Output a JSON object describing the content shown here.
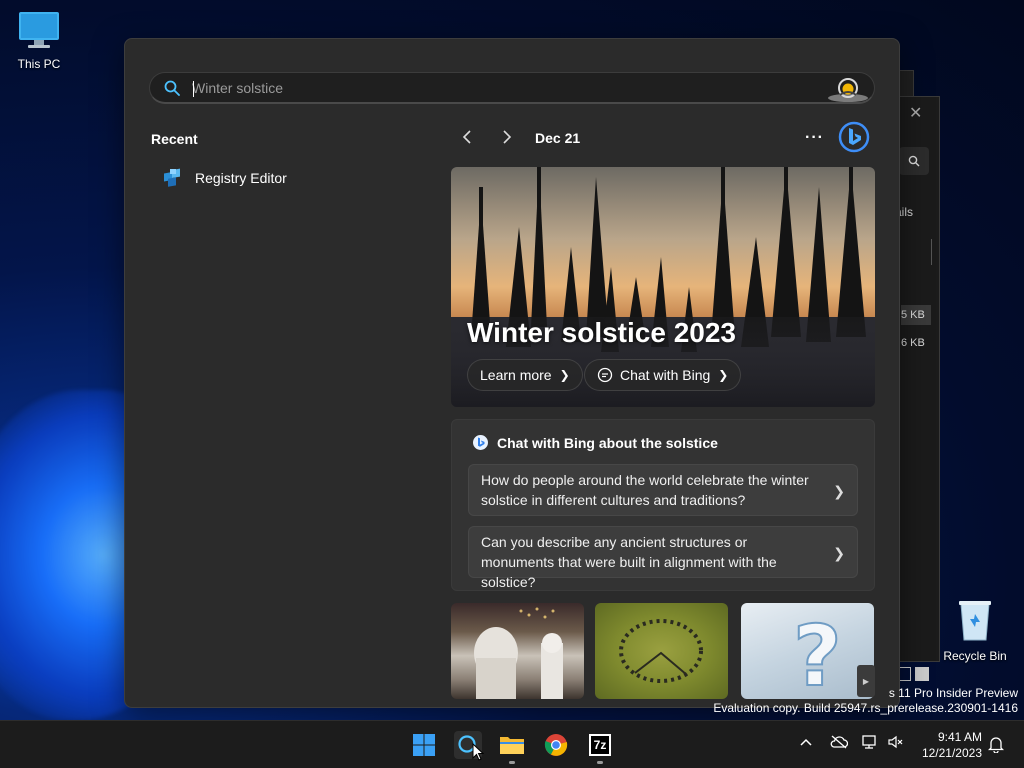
{
  "desktop": {
    "icons": [
      {
        "label": "This PC",
        "icon": "monitor-icon"
      },
      {
        "label": "Recycle Bin",
        "icon": "recycle-bin-icon"
      }
    ],
    "watermark": {
      "line1": "s 11 Pro Insider Preview",
      "line2": "Evaluation copy. Build 25947.rs_prerelease.230901-1416"
    },
    "background_window": {
      "tab_text": "ails",
      "size1": "5 KB",
      "size2": "6 KB"
    }
  },
  "search": {
    "placeholder": "Winter solstice",
    "value": ""
  },
  "recent": {
    "title": "Recent",
    "items": [
      {
        "label": "Registry Editor",
        "icon": "registry-editor-icon"
      }
    ]
  },
  "highlight": {
    "date": "Dec 21",
    "more": "···",
    "hero_title": "Winter solstice 2023",
    "learn_more": "Learn more",
    "chat_with_bing": "Chat with Bing"
  },
  "chat": {
    "title": "Chat with Bing about the solstice",
    "questions": [
      {
        "text": "How do people around the world celebrate the winter solstice in different cultures and traditions?"
      },
      {
        "text": "Can you describe any ancient structures or monuments that were built in alignment with the solstice?"
      }
    ]
  },
  "taskbar": {
    "apps": [
      "start-icon",
      "search-icon",
      "file-explorer-icon",
      "chrome-icon",
      "7zip-icon"
    ],
    "sevenzip_label": "7z",
    "clock_time": "9:41 AM",
    "clock_date": "12/21/2023"
  },
  "colors": {
    "accent": "#4cc2ff",
    "panel": "#2b2b2b",
    "taskbar": "#1c1c1c"
  }
}
